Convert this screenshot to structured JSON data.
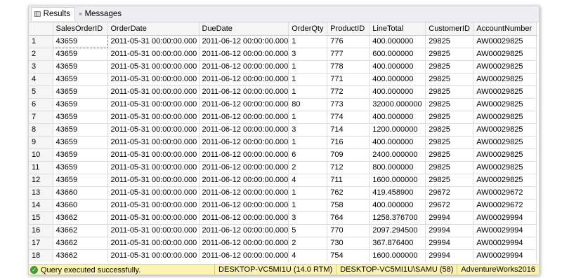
{
  "tabs": {
    "results": "Results",
    "messages": "Messages"
  },
  "grid": {
    "columns": [
      "",
      "SalesOrderID",
      "OrderDate",
      "DueDate",
      "OrderQty",
      "ProductID",
      "LineTotal",
      "CustomerID",
      "AccountNumber"
    ],
    "rows": [
      [
        "1",
        "43659",
        "2011-05-31 00:00:00.000",
        "2011-06-12 00:00:00.000",
        "1",
        "776",
        "400.000000",
        "29825",
        "AW00029825"
      ],
      [
        "2",
        "43659",
        "2011-05-31 00:00:00.000",
        "2011-06-12 00:00:00.000",
        "3",
        "777",
        "600.000000",
        "29825",
        "AW00029825"
      ],
      [
        "3",
        "43659",
        "2011-05-31 00:00:00.000",
        "2011-06-12 00:00:00.000",
        "1",
        "778",
        "400.000000",
        "29825",
        "AW00029825"
      ],
      [
        "4",
        "43659",
        "2011-05-31 00:00:00.000",
        "2011-06-12 00:00:00.000",
        "1",
        "771",
        "400.000000",
        "29825",
        "AW00029825"
      ],
      [
        "5",
        "43659",
        "2011-05-31 00:00:00.000",
        "2011-06-12 00:00:00.000",
        "1",
        "772",
        "400.000000",
        "29825",
        "AW00029825"
      ],
      [
        "6",
        "43659",
        "2011-05-31 00:00:00.000",
        "2011-06-12 00:00:00.000",
        "80",
        "773",
        "32000.000000",
        "29825",
        "AW00029825"
      ],
      [
        "7",
        "43659",
        "2011-05-31 00:00:00.000",
        "2011-06-12 00:00:00.000",
        "1",
        "774",
        "400.000000",
        "29825",
        "AW00029825"
      ],
      [
        "8",
        "43659",
        "2011-05-31 00:00:00.000",
        "2011-06-12 00:00:00.000",
        "3",
        "714",
        "1200.000000",
        "29825",
        "AW00029825"
      ],
      [
        "9",
        "43659",
        "2011-05-31 00:00:00.000",
        "2011-06-12 00:00:00.000",
        "1",
        "716",
        "400.000000",
        "29825",
        "AW00029825"
      ],
      [
        "10",
        "43659",
        "2011-05-31 00:00:00.000",
        "2011-06-12 00:00:00.000",
        "6",
        "709",
        "2400.000000",
        "29825",
        "AW00029825"
      ],
      [
        "11",
        "43659",
        "2011-05-31 00:00:00.000",
        "2011-06-12 00:00:00.000",
        "2",
        "712",
        "800.000000",
        "29825",
        "AW00029825"
      ],
      [
        "12",
        "43659",
        "2011-05-31 00:00:00.000",
        "2011-06-12 00:00:00.000",
        "4",
        "711",
        "1600.000000",
        "29825",
        "AW00029825"
      ],
      [
        "13",
        "43660",
        "2011-05-31 00:00:00.000",
        "2011-06-12 00:00:00.000",
        "1",
        "762",
        "419.458900",
        "29672",
        "AW00029672"
      ],
      [
        "14",
        "43660",
        "2011-05-31 00:00:00.000",
        "2011-06-12 00:00:00.000",
        "1",
        "758",
        "400.000000",
        "29672",
        "AW00029672"
      ],
      [
        "15",
        "43662",
        "2011-05-31 00:00:00.000",
        "2011-06-12 00:00:00.000",
        "3",
        "764",
        "1258.376700",
        "29994",
        "AW00029994"
      ],
      [
        "16",
        "43662",
        "2011-05-31 00:00:00.000",
        "2011-06-12 00:00:00.000",
        "5",
        "770",
        "2097.294500",
        "29994",
        "AW00029994"
      ],
      [
        "17",
        "43662",
        "2011-05-31 00:00:00.000",
        "2011-06-12 00:00:00.000",
        "2",
        "730",
        "367.876400",
        "29994",
        "AW00029994"
      ],
      [
        "18",
        "43662",
        "2011-05-31 00:00:00.000",
        "2011-06-12 00:00:00.000",
        "4",
        "754",
        "1600.000000",
        "29994",
        "AW00029994"
      ]
    ]
  },
  "status": {
    "message": "Query executed successfully.",
    "server": "DESKTOP-VC5MI1U (14.0 RTM)",
    "user": "DESKTOP-VC5MI1U\\SAMU (58)",
    "database": "AdventureWorks2016",
    "icon": "check-circle-icon",
    "bar_color": "#fdf4b0"
  }
}
